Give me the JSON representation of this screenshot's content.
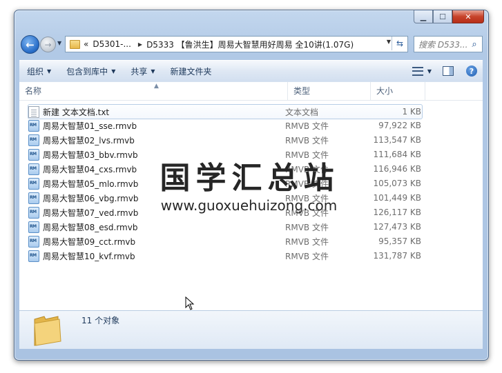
{
  "window": {
    "address": {
      "prefix": "«",
      "crumb1": "D5301-...",
      "crumb2": "D5333 【鲁洪生】周易大智慧用好周易 全10讲(1.07G)"
    },
    "search_placeholder": "搜索 D533..."
  },
  "toolbar": {
    "organize": "组织",
    "include_library": "包含到库中",
    "share": "共享",
    "new_folder": "新建文件夹"
  },
  "columns": {
    "name": "名称",
    "type": "类型",
    "size": "大小"
  },
  "files": [
    {
      "name": "新建 文本文档.txt",
      "type": "文本文档",
      "size": "1 KB",
      "icon": "text-file-icon"
    },
    {
      "name": "周易大智慧01_sse.rmvb",
      "type": "RMVB 文件",
      "size": "97,922 KB",
      "icon": "rmvb-file-icon"
    },
    {
      "name": "周易大智慧02_lvs.rmvb",
      "type": "RMVB 文件",
      "size": "113,547 KB",
      "icon": "rmvb-file-icon"
    },
    {
      "name": "周易大智慧03_bbv.rmvb",
      "type": "RMVB 文件",
      "size": "111,684 KB",
      "icon": "rmvb-file-icon"
    },
    {
      "name": "周易大智慧04_cxs.rmvb",
      "type": "RMVB 文件",
      "size": "116,946 KB",
      "icon": "rmvb-file-icon"
    },
    {
      "name": "周易大智慧05_mlo.rmvb",
      "type": "RMVB 文件",
      "size": "105,073 KB",
      "icon": "rmvb-file-icon"
    },
    {
      "name": "周易大智慧06_vbg.rmvb",
      "type": "RMVB 文件",
      "size": "101,449 KB",
      "icon": "rmvb-file-icon"
    },
    {
      "name": "周易大智慧07_ved.rmvb",
      "type": "RMVB 文件",
      "size": "126,117 KB",
      "icon": "rmvb-file-icon"
    },
    {
      "name": "周易大智慧08_esd.rmvb",
      "type": "RMVB 文件",
      "size": "127,473 KB",
      "icon": "rmvb-file-icon"
    },
    {
      "name": "周易大智慧09_cct.rmvb",
      "type": "RMVB 文件",
      "size": "95,357 KB",
      "icon": "rmvb-file-icon"
    },
    {
      "name": "周易大智慧10_kvf.rmvb",
      "type": "RMVB 文件",
      "size": "131,787 KB",
      "icon": "rmvb-file-icon"
    }
  ],
  "watermark": {
    "title": "国学汇总站",
    "url": "www.guoxuehuizong.com"
  },
  "details": {
    "count": "11 个对象"
  }
}
